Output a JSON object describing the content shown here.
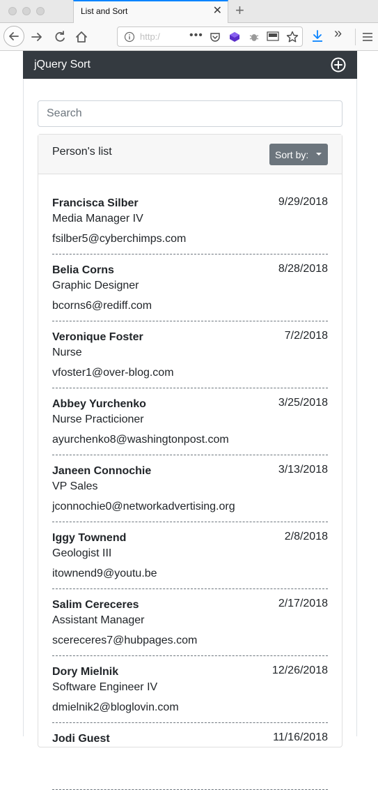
{
  "browser": {
    "tab_title": "List and Sort",
    "url": "http:/"
  },
  "app": {
    "brand": "jQuery Sort"
  },
  "search": {
    "placeholder": "Search"
  },
  "card": {
    "title": "Person's list",
    "sort_label": "Sort by:"
  },
  "people": [
    {
      "name": "Francisca Silber",
      "role": "Media Manager IV",
      "email": "fsilber5@cyberchimps.com",
      "date": "9/29/2018"
    },
    {
      "name": "Belia Corns",
      "role": "Graphic Designer",
      "email": "bcorns6@rediff.com",
      "date": "8/28/2018"
    },
    {
      "name": "Veronique Foster",
      "role": "Nurse",
      "email": "vfoster1@over-blog.com",
      "date": "7/2/2018"
    },
    {
      "name": "Abbey Yurchenko",
      "role": "Nurse Practicioner",
      "email": "ayurchenko8@washingtonpost.com",
      "date": "3/25/2018"
    },
    {
      "name": "Janeen Connochie",
      "role": "VP Sales",
      "email": "jconnochie0@networkadvertising.org",
      "date": "3/13/2018"
    },
    {
      "name": "Iggy Townend",
      "role": "Geologist III",
      "email": "itownend9@youtu.be",
      "date": "2/8/2018"
    },
    {
      "name": "Salim Cereceres",
      "role": "Assistant Manager",
      "email": "scereceres7@hubpages.com",
      "date": "2/17/2018"
    },
    {
      "name": "Dory Mielnik",
      "role": "Software Engineer IV",
      "email": "dmielnik2@bloglovin.com",
      "date": "12/26/2018"
    },
    {
      "name": "Jodi Guest",
      "role": "",
      "email": "",
      "date": "11/16/2018"
    }
  ]
}
